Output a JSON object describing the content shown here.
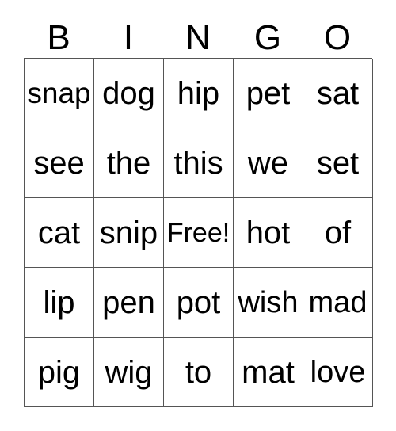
{
  "card": {
    "header": {
      "letters": [
        "B",
        "I",
        "N",
        "G",
        "O"
      ]
    },
    "grid": {
      "rows": [
        {
          "cells": [
            {
              "text": "snap",
              "free": false
            },
            {
              "text": "dog",
              "free": false
            },
            {
              "text": "hip",
              "free": false
            },
            {
              "text": "pet",
              "free": false
            },
            {
              "text": "sat",
              "free": false
            }
          ]
        },
        {
          "cells": [
            {
              "text": "see",
              "free": false
            },
            {
              "text": "the",
              "free": false
            },
            {
              "text": "this",
              "free": false
            },
            {
              "text": "we",
              "free": false
            },
            {
              "text": "set",
              "free": false
            }
          ]
        },
        {
          "cells": [
            {
              "text": "cat",
              "free": false
            },
            {
              "text": "snip",
              "free": false
            },
            {
              "text": "Free!",
              "free": true
            },
            {
              "text": "hot",
              "free": false
            },
            {
              "text": "of",
              "free": false
            }
          ]
        },
        {
          "cells": [
            {
              "text": "lip",
              "free": false
            },
            {
              "text": "pen",
              "free": false
            },
            {
              "text": "pot",
              "free": false
            },
            {
              "text": "wish",
              "free": false
            },
            {
              "text": "mad",
              "free": false
            }
          ]
        },
        {
          "cells": [
            {
              "text": "pig",
              "free": false
            },
            {
              "text": "wig",
              "free": false
            },
            {
              "text": "to",
              "free": false
            },
            {
              "text": "mat",
              "free": false
            },
            {
              "text": "love",
              "free": false
            }
          ]
        }
      ]
    },
    "colors": {
      "background": "#ffffff",
      "text": "#000000",
      "gridline": "#555555"
    }
  }
}
